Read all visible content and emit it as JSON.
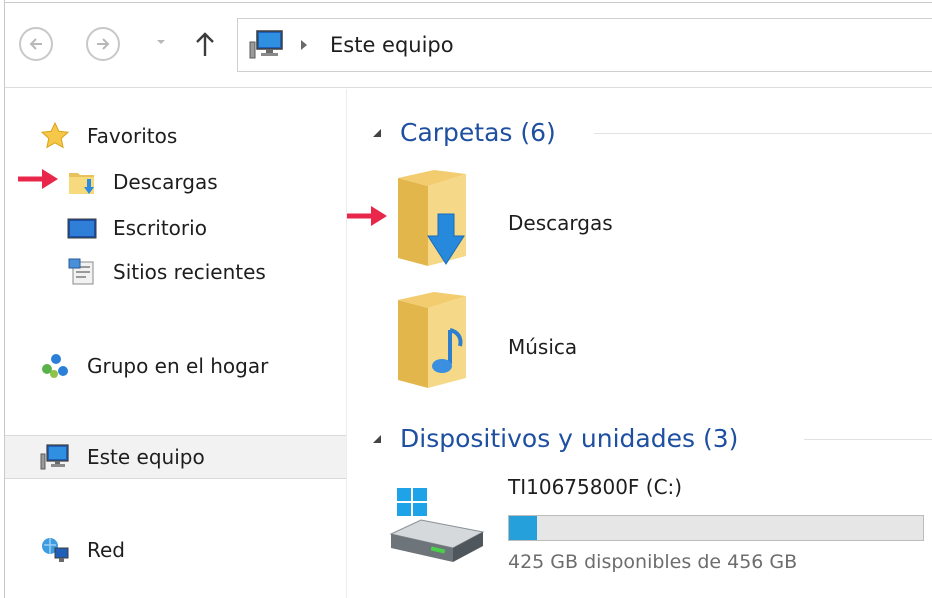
{
  "address_bar": {
    "path_segments": [
      "Este equipo"
    ],
    "back_icon": "back-arrow-icon",
    "forward_icon": "forward-arrow-icon",
    "up_icon": "up-arrow-icon",
    "location_icon": "computer-icon"
  },
  "nav_pane": {
    "favorites": {
      "label": "Favoritos",
      "items": [
        {
          "label": "Descargas",
          "icon": "downloads-folder-icon"
        },
        {
          "label": "Escritorio",
          "icon": "desktop-icon"
        },
        {
          "label": "Sitios recientes",
          "icon": "recent-places-icon"
        }
      ]
    },
    "homegroup": {
      "label": "Grupo en el hogar",
      "icon": "homegroup-icon"
    },
    "this_pc": {
      "label": "Este equipo",
      "icon": "computer-icon",
      "selected": true
    },
    "network": {
      "label": "Red",
      "icon": "network-icon"
    }
  },
  "main": {
    "folders_group": {
      "title": "Carpetas (6)",
      "items": [
        {
          "label": "Descargas",
          "icon": "downloads-folder-icon"
        },
        {
          "label": "Música",
          "icon": "music-folder-icon"
        }
      ]
    },
    "devices_group": {
      "title": "Dispositivos y unidades (3)",
      "drive": {
        "label": "TI10675800F (C:)",
        "free_text": "425 GB disponibles de 456 GB",
        "used_fraction": 0.068,
        "icon": "windows-drive-icon"
      }
    }
  },
  "colors": {
    "group_title": "#1e4fa0",
    "progress_fill": "#26a0da",
    "annotation_arrow": "#e8274b",
    "selected_bg": "#f2f2f2"
  }
}
